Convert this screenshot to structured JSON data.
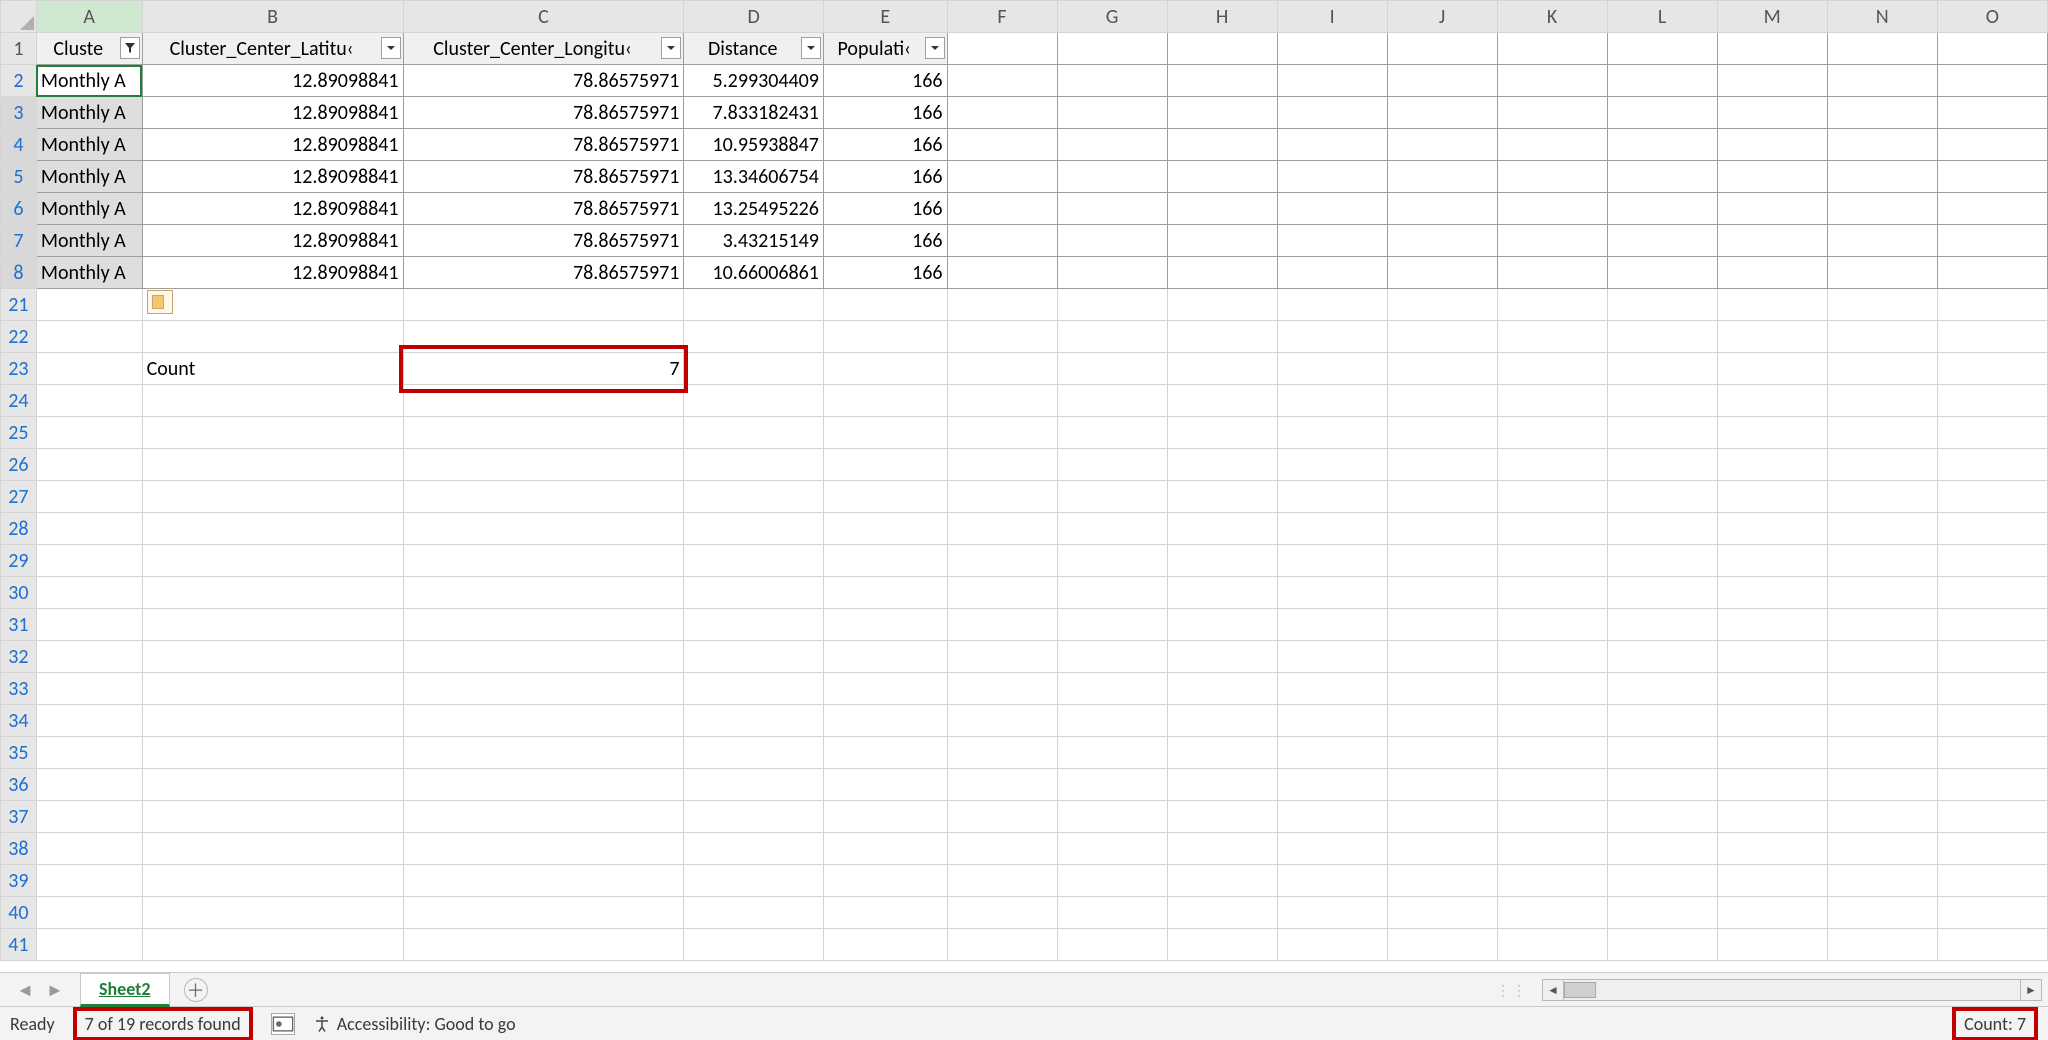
{
  "columns": [
    "A",
    "B",
    "C",
    "D",
    "E",
    "F",
    "G",
    "H",
    "I",
    "J",
    "K",
    "L",
    "M",
    "N",
    "O"
  ],
  "header_row": {
    "A": {
      "label": "Cluste",
      "filtered": true
    },
    "B": {
      "label": "Cluster_Center_Latitu‹",
      "filtered": false
    },
    "C": {
      "label": "Cluster_Center_Longitu‹",
      "filtered": false
    },
    "D": {
      "label": "Distance",
      "filtered": false
    },
    "E": {
      "label": "Populati‹",
      "filtered": false
    }
  },
  "data_rows": [
    {
      "n": 2,
      "A": "Monthly A",
      "B": "12.89098841",
      "C": "78.86575971",
      "D": "5.299304409",
      "E": "166"
    },
    {
      "n": 3,
      "A": "Monthly A",
      "B": "12.89098841",
      "C": "78.86575971",
      "D": "7.833182431",
      "E": "166"
    },
    {
      "n": 4,
      "A": "Monthly A",
      "B": "12.89098841",
      "C": "78.86575971",
      "D": "10.95938847",
      "E": "166"
    },
    {
      "n": 5,
      "A": "Monthly A",
      "B": "12.89098841",
      "C": "78.86575971",
      "D": "13.34606754",
      "E": "166"
    },
    {
      "n": 6,
      "A": "Monthly A",
      "B": "12.89098841",
      "C": "78.86575971",
      "D": "13.25495226",
      "E": "166"
    },
    {
      "n": 7,
      "A": "Monthly A",
      "B": "12.89098841",
      "C": "78.86575971",
      "D": "3.43215149",
      "E": "166"
    },
    {
      "n": 8,
      "A": "Monthly A",
      "B": "12.89098841",
      "C": "78.86575971",
      "D": "10.66006861",
      "E": "166"
    }
  ],
  "blank_rows_after_data": [
    21,
    22
  ],
  "count_row": {
    "n": 23,
    "label": "Count",
    "value": "7"
  },
  "trailing_blank_rows": [
    24,
    25,
    26,
    27,
    28,
    29,
    30,
    31,
    32,
    33,
    34,
    35,
    36,
    37,
    38,
    39,
    40,
    41
  ],
  "sheet_tab": "Sheet2",
  "status": {
    "ready": "Ready",
    "records": "7 of 19 records found",
    "accessibility": "Accessibility: Good to go",
    "count": "Count: 7"
  },
  "annotations": {
    "red_box_count_cell": true,
    "red_box_records": true,
    "red_box_statuscount": true
  }
}
